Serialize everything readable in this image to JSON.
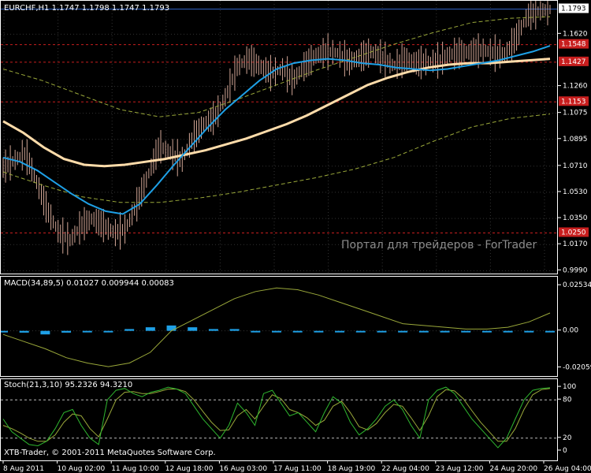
{
  "chart_data": [
    {
      "type": "line",
      "title": "EURCHF,H1  1.1747 1.1798 1.1747 1.1793",
      "symbol": "EURCHF",
      "timeframe": "H1",
      "ohlc": {
        "open": 1.1747,
        "high": 1.1798,
        "low": 1.1747,
        "close": 1.1793
      },
      "y_ticks": [
        "1.1793",
        "1.1620",
        "1.1260",
        "1.1075",
        "1.0895",
        "1.0710",
        "1.0530",
        "1.0350",
        "1.0170",
        "0.9990"
      ],
      "ylim": [
        0.997,
        1.185
      ],
      "price_levels": [
        "1.1548",
        "1.1427",
        "1.1153",
        "1.0250"
      ],
      "watermark": "Портал для трейдеров - ForTrader",
      "series": [
        {
          "color": "#d2a696",
          "style": "candles",
          "values": [
            1.07,
            1.075,
            1.08,
            1.06,
            1.04,
            1.025,
            1.02,
            1.03,
            1.035,
            1.03,
            1.025,
            1.028,
            1.045,
            1.065,
            1.085,
            1.08,
            1.075,
            1.09,
            1.1,
            1.105,
            1.12,
            1.14,
            1.145,
            1.14,
            1.135,
            1.138,
            1.13,
            1.14,
            1.147,
            1.15,
            1.149,
            1.143,
            1.146,
            1.15,
            1.146,
            1.14,
            1.145,
            1.142,
            1.143,
            1.144,
            1.148,
            1.149,
            1.15,
            1.151,
            1.149,
            1.148,
            1.16,
            1.175,
            1.178,
            1.179
          ]
        },
        {
          "color": "#1ea0e6",
          "values": [
            1.077,
            1.074,
            1.068,
            1.06,
            1.052,
            1.045,
            1.04,
            1.038,
            1.045,
            1.058,
            1.072,
            1.085,
            1.098,
            1.11,
            1.12,
            1.13,
            1.138,
            1.142,
            1.144,
            1.145,
            1.144,
            1.142,
            1.141,
            1.139,
            1.138,
            1.137,
            1.138,
            1.14,
            1.142,
            1.144,
            1.147,
            1.15,
            1.154
          ]
        },
        {
          "color": "#ffdcaa",
          "values": [
            1.102,
            1.094,
            1.084,
            1.076,
            1.072,
            1.071,
            1.072,
            1.074,
            1.076,
            1.079,
            1.082,
            1.086,
            1.09,
            1.095,
            1.1,
            1.106,
            1.113,
            1.12,
            1.127,
            1.132,
            1.136,
            1.139,
            1.141,
            1.142,
            1.142,
            1.143,
            1.144,
            1.145
          ]
        },
        {
          "color": "#9aa83a",
          "style": "dashed",
          "values": [
            1.138,
            1.13,
            1.12,
            1.11,
            1.105,
            1.108,
            1.117,
            1.127,
            1.137,
            1.146,
            1.155,
            1.163,
            1.17,
            1.173,
            1.174
          ]
        },
        {
          "color": "#9aa83a",
          "style": "dashed",
          "values": [
            1.067,
            1.058,
            1.05,
            1.046,
            1.046,
            1.049,
            1.053,
            1.058,
            1.063,
            1.069,
            1.077,
            1.088,
            1.098,
            1.104,
            1.107
          ]
        }
      ]
    },
    {
      "type": "line",
      "title": "MACD(34,89,5) 0.01027 0.009944 0.00083",
      "y_ticks": [
        "0.02534",
        "0.00",
        "-0.02059"
      ],
      "ylim": [
        -0.0235,
        0.0285
      ],
      "series": [
        {
          "color": "#9aa83a",
          "values": [
            -0.002,
            -0.006,
            -0.01,
            -0.015,
            -0.018,
            -0.02,
            -0.018,
            -0.012,
            0.0,
            0.006,
            0.012,
            0.018,
            0.022,
            0.024,
            0.023,
            0.02,
            0.016,
            0.012,
            0.008,
            0.004,
            0.003,
            0.002,
            0.001,
            0.001,
            0.002,
            0.005,
            0.01
          ]
        },
        {
          "color": "#1ea0e6",
          "style": "histogram",
          "values": [
            0.0,
            -0.001,
            -0.002,
            -0.001,
            0.0,
            0.0,
            0.001,
            0.002,
            0.003,
            0.002,
            0.001,
            0.001,
            0.0,
            0.0,
            0.0,
            0.0,
            0.0,
            0.0,
            0.0,
            0.0,
            0.0,
            0.0,
            0.0,
            0.0,
            0.0,
            0.0,
            0.0
          ]
        }
      ]
    },
    {
      "type": "line",
      "title": "Stoch(21,3,10) 95.2326 94.3210",
      "y_ticks": [
        "100",
        "80",
        "20",
        "0"
      ],
      "ylim": [
        -5,
        110
      ],
      "series": [
        {
          "color": "#2fb82f",
          "values": [
            50,
            30,
            20,
            10,
            8,
            15,
            35,
            60,
            65,
            40,
            20,
            10,
            80,
            95,
            98,
            90,
            85,
            92,
            95,
            100,
            97,
            90,
            70,
            50,
            35,
            20,
            40,
            75,
            60,
            40,
            90,
            95,
            75,
            55,
            60,
            45,
            30,
            60,
            85,
            75,
            45,
            25,
            35,
            50,
            70,
            80,
            65,
            40,
            20,
            80,
            95,
            100,
            90,
            70,
            50,
            35,
            20,
            5,
            20,
            50,
            80,
            95,
            98,
            99
          ]
        },
        {
          "color": "#9aa83a",
          "values": [
            40,
            35,
            28,
            20,
            15,
            15,
            25,
            45,
            58,
            55,
            35,
            22,
            50,
            80,
            92,
            93,
            90,
            90,
            93,
            97,
            97,
            93,
            80,
            62,
            45,
            32,
            33,
            55,
            65,
            50,
            70,
            88,
            82,
            65,
            60,
            52,
            40,
            48,
            70,
            78,
            60,
            38,
            33,
            43,
            60,
            73,
            70,
            52,
            32,
            55,
            85,
            96,
            94,
            82,
            63,
            45,
            30,
            15,
            15,
            35,
            65,
            88,
            96,
            98
          ]
        }
      ]
    }
  ],
  "x_ticks": [
    "8 Aug 2011",
    "10 Aug 02:00",
    "11 Aug 10:00",
    "12 Aug 18:00",
    "16 Aug 03:00",
    "17 Aug 11:00",
    "18 Aug 19:00",
    "22 Aug 04:00",
    "23 Aug 12:00",
    "24 Aug 20:00",
    "26 Aug 04:00"
  ],
  "footer": "XTB-Trader, © 2001-2011 MetaQuotes Software Corp."
}
